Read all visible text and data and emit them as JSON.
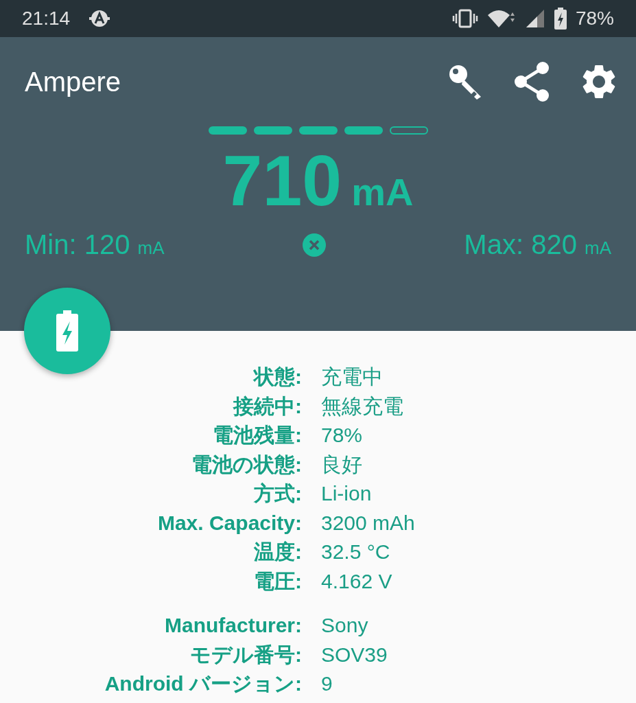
{
  "status_bar": {
    "time": "21:14",
    "battery_percent": "78%"
  },
  "app_bar": {
    "title": "Ampere"
  },
  "meter": {
    "level": 0.8,
    "value": "710",
    "unit": "mA",
    "min_label": "Min:",
    "min_value": "120",
    "min_unit": "mA",
    "max_label": "Max:",
    "max_value": "820",
    "max_unit": "mA"
  },
  "battery_info": [
    {
      "label": "状態:",
      "value": "充電中"
    },
    {
      "label": "接続中:",
      "value": "無線充電"
    },
    {
      "label": "電池残量:",
      "value": "78%"
    },
    {
      "label": "電池の状態:",
      "value": "良好"
    },
    {
      "label": "方式:",
      "value": "Li-ion"
    },
    {
      "label": "Max. Capacity:",
      "value": "3200 mAh"
    },
    {
      "label": "温度:",
      "value": "32.5 °C"
    },
    {
      "label": "電圧:",
      "value": "4.162 V"
    }
  ],
  "device_info": [
    {
      "label": "Manufacturer:",
      "value": "Sony"
    },
    {
      "label": "モデル番号:",
      "value": "SOV39"
    },
    {
      "label": "Android バージョン:",
      "value": "9"
    }
  ]
}
